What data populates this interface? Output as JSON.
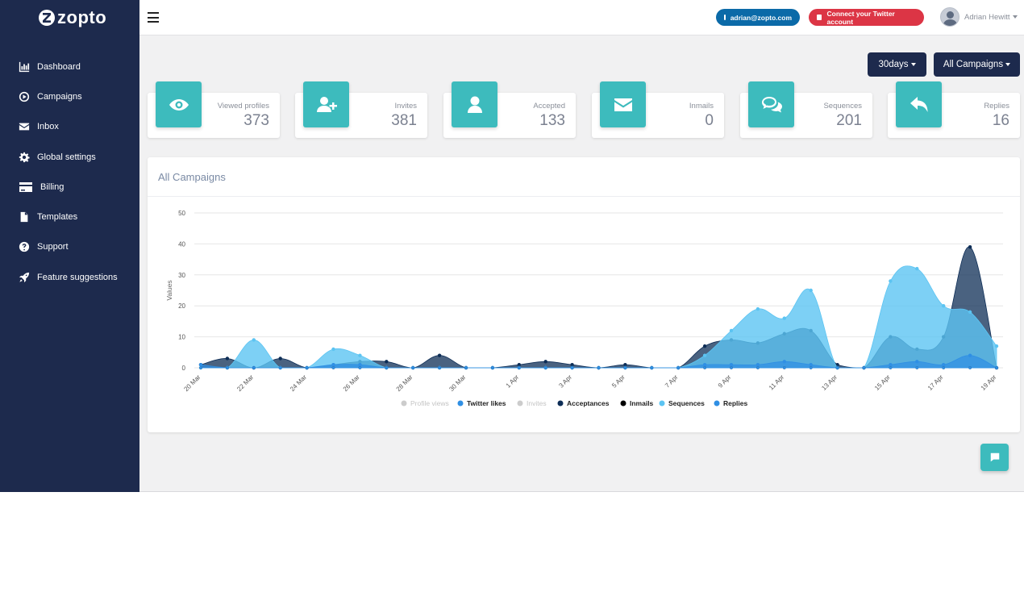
{
  "app": {
    "logo_text": "zopto"
  },
  "sidebar": {
    "items": [
      {
        "label": "Dashboard",
        "icon": "bar-chart-icon"
      },
      {
        "label": "Campaigns",
        "icon": "play-circle-icon"
      },
      {
        "label": "Inbox",
        "icon": "envelope-icon"
      },
      {
        "label": "Global settings",
        "icon": "gear-icon"
      },
      {
        "label": "Billing",
        "icon": "credit-card-icon"
      },
      {
        "label": "Templates",
        "icon": "file-icon"
      },
      {
        "label": "Support",
        "icon": "question-circle-icon"
      },
      {
        "label": "Feature suggestions",
        "icon": "rocket-icon"
      }
    ]
  },
  "topbar": {
    "email": "adrian@zopto.com",
    "twitter_button": "Connect your Twitter account",
    "user_name": "Adrian Hewitt"
  },
  "filters": {
    "period": "30days",
    "campaign": "All Campaigns"
  },
  "stats": [
    {
      "label": "Viewed profiles",
      "value": "373",
      "icon": "eye-icon"
    },
    {
      "label": "Invites",
      "value": "381",
      "icon": "user-plus-icon"
    },
    {
      "label": "Accepted",
      "value": "133",
      "icon": "user-icon"
    },
    {
      "label": "Inmails",
      "value": "0",
      "icon": "envelope-icon"
    },
    {
      "label": "Sequences",
      "value": "201",
      "icon": "comments-icon"
    },
    {
      "label": "Replies",
      "value": "16",
      "icon": "reply-icon"
    }
  ],
  "panel": {
    "title": "All Campaigns"
  },
  "colors": {
    "sidebar": "#1d2a4d",
    "accent": "#3dbbbd",
    "twitter_button": "#dc3545",
    "email_button": "#0b6aa8"
  },
  "chart_data": {
    "type": "area",
    "ylabel": "Values",
    "ylim": [
      0,
      50
    ],
    "yticks": [
      0,
      10,
      20,
      30,
      40,
      50
    ],
    "x_tick_labels": [
      "20 Mar",
      "22 Mar",
      "24 Mar",
      "26 Mar",
      "28 Mar",
      "30 Mar",
      "1 Apr",
      "3 Apr",
      "5 Apr",
      "7 Apr",
      "9 Apr",
      "11 Apr",
      "13 Apr",
      "15 Apr",
      "17 Apr",
      "19 Apr"
    ],
    "x": [
      "20 Mar",
      "21 Mar",
      "22 Mar",
      "23 Mar",
      "24 Mar",
      "25 Mar",
      "26 Mar",
      "27 Mar",
      "28 Mar",
      "29 Mar",
      "30 Mar",
      "31 Mar",
      "1 Apr",
      "2 Apr",
      "3 Apr",
      "4 Apr",
      "5 Apr",
      "6 Apr",
      "7 Apr",
      "8 Apr",
      "9 Apr",
      "10 Apr",
      "11 Apr",
      "12 Apr",
      "13 Apr",
      "14 Apr",
      "15 Apr",
      "16 Apr",
      "17 Apr",
      "18 Apr",
      "19 Apr"
    ],
    "legend_position": "bottom",
    "series": [
      {
        "name": "Profile views",
        "color": "#cccccc",
        "hidden": true,
        "values": []
      },
      {
        "name": "Twitter likes",
        "color": "#2f8fe4",
        "values": [
          0,
          0,
          0,
          0,
          0,
          0,
          0,
          0,
          0,
          0,
          0,
          0,
          0,
          0,
          0,
          0,
          0,
          0,
          0,
          0,
          0,
          0,
          0,
          0,
          0,
          0,
          0,
          0,
          0,
          0,
          0
        ]
      },
      {
        "name": "Invites",
        "color": "#cccccc",
        "hidden": true,
        "values": []
      },
      {
        "name": "Acceptances",
        "color": "#0d2d56",
        "values": [
          1,
          3,
          0,
          3,
          0,
          1,
          2,
          2,
          0,
          4,
          0,
          0,
          1,
          2,
          1,
          0,
          1,
          0,
          0,
          7,
          9,
          8,
          11,
          12,
          1,
          0,
          10,
          6,
          10,
          39,
          0
        ]
      },
      {
        "name": "Inmails",
        "color": "#000000",
        "values": [
          0,
          0,
          0,
          0,
          0,
          0,
          0,
          0,
          0,
          0,
          0,
          0,
          0,
          0,
          0,
          0,
          0,
          0,
          0,
          0,
          0,
          0,
          0,
          0,
          0,
          0,
          0,
          0,
          0,
          0,
          0
        ]
      },
      {
        "name": "Sequences",
        "color": "#5cc4f2",
        "values": [
          0,
          0,
          9,
          0,
          0,
          6,
          4,
          0,
          0,
          0,
          0,
          0,
          0,
          0,
          0,
          0,
          0,
          0,
          0,
          4,
          12,
          19,
          16,
          25,
          0,
          0,
          28,
          32,
          20,
          18,
          7
        ]
      },
      {
        "name": "Replies",
        "color": "#2f8fe4",
        "values": [
          1,
          0,
          0,
          0,
          0,
          1,
          1,
          0,
          0,
          0,
          0,
          0,
          0,
          0,
          0,
          0,
          0,
          0,
          0,
          1,
          1,
          1,
          2,
          1,
          0,
          0,
          1,
          2,
          1,
          4,
          0
        ]
      }
    ]
  }
}
